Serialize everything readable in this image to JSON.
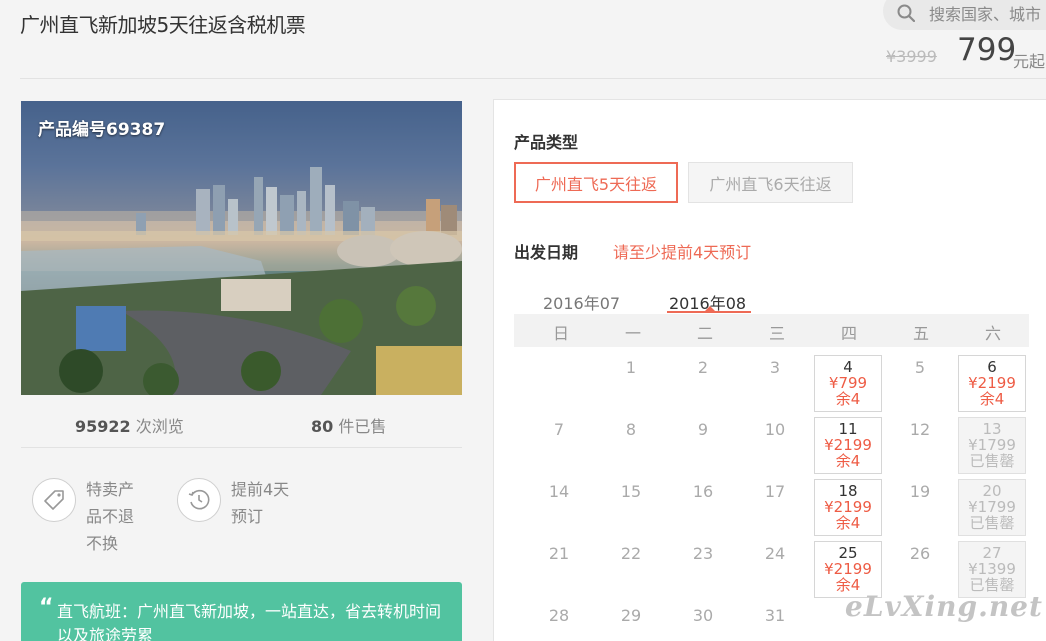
{
  "header": {
    "title": "广州直飞新加坡5天往返含税机票",
    "search_placeholder": "搜索国家、城市",
    "old_price": "¥3999",
    "price": "799",
    "price_unit": "元起"
  },
  "product": {
    "code": "产品编号69387",
    "views_num": "95922",
    "views_label": "次浏览",
    "sold_num": "80",
    "sold_label": "件已售",
    "features": [
      {
        "text": "特卖产品不退不换",
        "icon": "tag-icon"
      },
      {
        "text": "提前4天预订",
        "icon": "clock-icon"
      }
    ],
    "banner": "直飞航班：广州直飞新加坡，一站直达，省去转机时间以及旅途劳累"
  },
  "booking": {
    "type_label": "产品类型",
    "options": [
      "广州直飞5天往返",
      "广州直飞6天往返"
    ],
    "selected_option": 0,
    "date_label": "出发日期",
    "date_hint": "请至少提前4天预订",
    "months": [
      "2016年07",
      "2016年08"
    ],
    "selected_month": 1,
    "weekdays": [
      "日",
      "一",
      "二",
      "三",
      "四",
      "五",
      "六"
    ],
    "rows": [
      [
        {
          "d": ""
        },
        {
          "d": "1"
        },
        {
          "d": "2"
        },
        {
          "d": "3"
        },
        {
          "d": "4",
          "p": "¥799",
          "s": "余4"
        },
        {
          "d": "5"
        },
        {
          "d": "6",
          "p": "¥2199",
          "s": "余4"
        }
      ],
      [
        {
          "d": "7"
        },
        {
          "d": "8"
        },
        {
          "d": "9"
        },
        {
          "d": "10"
        },
        {
          "d": "11",
          "p": "¥2199",
          "s": "余4"
        },
        {
          "d": "12"
        },
        {
          "d": "13",
          "p": "¥1799",
          "s": "已售罄",
          "sold": true
        }
      ],
      [
        {
          "d": "14"
        },
        {
          "d": "15"
        },
        {
          "d": "16"
        },
        {
          "d": "17"
        },
        {
          "d": "18",
          "p": "¥2199",
          "s": "余4"
        },
        {
          "d": "19"
        },
        {
          "d": "20",
          "p": "¥1799",
          "s": "已售罄",
          "sold": true
        }
      ],
      [
        {
          "d": "21"
        },
        {
          "d": "22"
        },
        {
          "d": "23"
        },
        {
          "d": "24"
        },
        {
          "d": "25",
          "p": "¥2199",
          "s": "余4"
        },
        {
          "d": "26"
        },
        {
          "d": "27",
          "p": "¥1399",
          "s": "已售罄",
          "sold": true
        }
      ],
      [
        {
          "d": "28"
        },
        {
          "d": "29"
        },
        {
          "d": "30"
        },
        {
          "d": "31"
        },
        {
          "d": ""
        },
        {
          "d": ""
        },
        {
          "d": ""
        }
      ]
    ]
  },
  "watermark": "eLvXing.net",
  "colors": {
    "accent": "#ee6a55",
    "banner": "#52c3a0"
  }
}
